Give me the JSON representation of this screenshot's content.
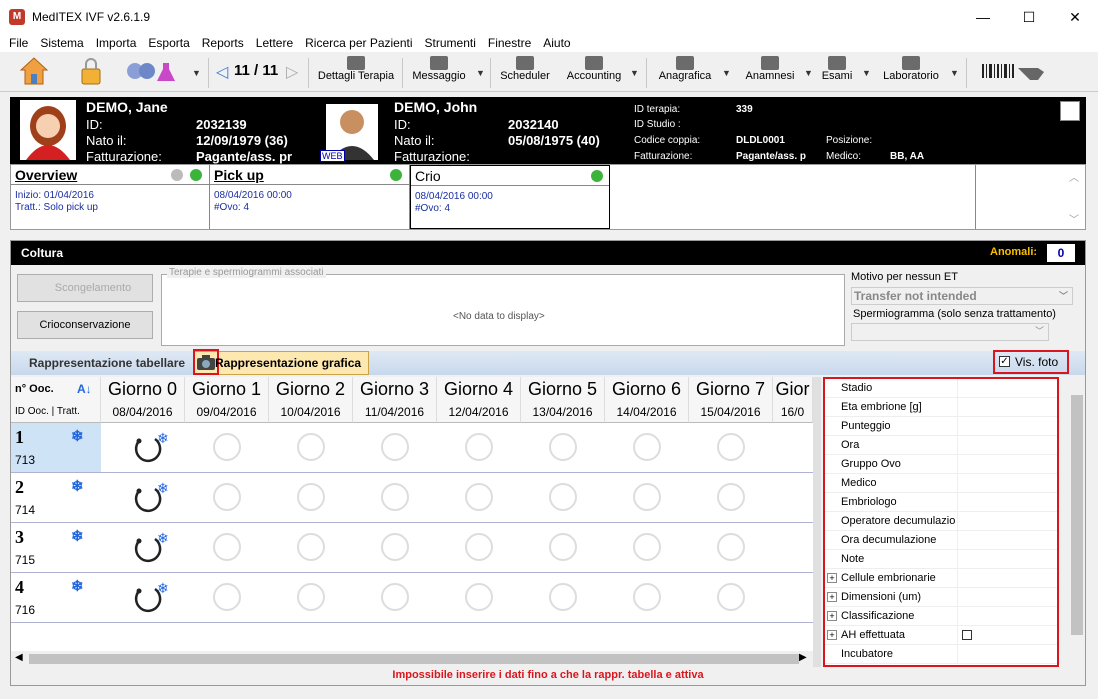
{
  "window": {
    "title": "MedITEX IVF v2.6.1.9",
    "min": "—",
    "max": "☐",
    "close": "✕"
  },
  "menu": [
    "File",
    "Sistema",
    "Importa",
    "Esporta",
    "Reports",
    "Lettere",
    "Ricerca per Pazienti",
    "Strumenti",
    "Finestre",
    "Aiuto"
  ],
  "toolbar": {
    "counter": "11 / 11",
    "dettagli": "Dettagli Terapia",
    "messaggio": "Messaggio",
    "scheduler": "Scheduler",
    "accounting": "Accounting",
    "anagrafica": "Anagrafica",
    "anamnesi": "Anamnesi",
    "esami": "Esami",
    "laboratorio": "Laboratorio"
  },
  "patient_f": {
    "name": "DEMO, Jane",
    "id_label": "ID:",
    "id": "2032139",
    "dob_label": "Nato il:",
    "dob": "12/09/1979  (36)",
    "billing_label": "Fatturazione:",
    "billing": "Pagante/ass. pr"
  },
  "patient_m": {
    "name": "DEMO, John",
    "id_label": "ID:",
    "id": "2032140",
    "dob_label": "Nato il:",
    "dob": "05/08/1975  (40)",
    "billing_label": "Fatturazione:",
    "web": "WEB"
  },
  "therapy": {
    "id_terapia_label": "ID terapia:",
    "id_terapia": "339",
    "id_studio_label": "ID Studio :",
    "codice_label": "Codice coppia:",
    "codice": "DLDL0001",
    "posizione_label": "Posizione:",
    "fatt_label": "Fatturazione:",
    "fatt": "Pagante/ass. p",
    "medico_label": "Medico:",
    "medico": "BB, AA"
  },
  "phases": [
    {
      "title": "Overview",
      "l1": "Inizio:  01/04/2016",
      "l2": "Tratt.: Solo pick up"
    },
    {
      "title": "Pick up",
      "l1": "08/04/2016 00:00",
      "l2": "#Ovo: 4"
    },
    {
      "title": "Crio",
      "l1": "08/04/2016 00:00",
      "l2": "#Ovo: 4"
    }
  ],
  "coltura": {
    "title": "Coltura",
    "anomali_label": "Anomali:",
    "anomali": "0",
    "scongelamento": "Scongelamento",
    "crioconservazione": "Crioconservazione",
    "terapie_label": "Terapie e spermiogrammi associati",
    "nodata": "<No data to display>",
    "motivo_label": "Motivo per nessun ET",
    "motivo_value": "Transfer not intended",
    "spermio_label": "Spermiogramma (solo senza trattamento)",
    "tab_tabellare": "Rappresentazione tabellare",
    "tab_grafica": "Rappresentazione grafica",
    "vis_foto": "Vis. foto",
    "footer_msg": "Impossibile inserire i dati fino a che la rappr. tabella e attiva"
  },
  "grid": {
    "col1_h1": "n° Ooc.",
    "col1_h2": "ID Ooc. | Tratt.",
    "days": [
      "Giorno 0",
      "Giorno 1",
      "Giorno 2",
      "Giorno 3",
      "Giorno 4",
      "Giorno 5",
      "Giorno 6",
      "Giorno 7",
      "Gior"
    ],
    "dates": [
      "08/04/2016",
      "09/04/2016",
      "10/04/2016",
      "11/04/2016",
      "12/04/2016",
      "13/04/2016",
      "14/04/2016",
      "15/04/2016",
      "16/0"
    ],
    "rows": [
      {
        "n": "1",
        "id": "713"
      },
      {
        "n": "2",
        "id": "714"
      },
      {
        "n": "3",
        "id": "715"
      },
      {
        "n": "4",
        "id": "716"
      }
    ]
  },
  "props": [
    {
      "label": "Stadio",
      "exp": false
    },
    {
      "label": "Eta embrione [g]",
      "exp": false
    },
    {
      "label": "Punteggio",
      "exp": false
    },
    {
      "label": "Ora",
      "exp": false
    },
    {
      "label": "Gruppo Ovo",
      "exp": false
    },
    {
      "label": "Medico",
      "exp": false
    },
    {
      "label": "Embriologo",
      "exp": false
    },
    {
      "label": "Operatore decumulazio",
      "exp": false
    },
    {
      "label": "Ora decumulazione",
      "exp": false
    },
    {
      "label": "Note",
      "exp": false
    },
    {
      "label": "Cellule embrionarie",
      "exp": true
    },
    {
      "label": "Dimensioni (um)",
      "exp": true
    },
    {
      "label": "Classificazione",
      "exp": true
    },
    {
      "label": "AH effettuata",
      "exp": true
    },
    {
      "label": "Incubatore",
      "exp": false
    }
  ]
}
